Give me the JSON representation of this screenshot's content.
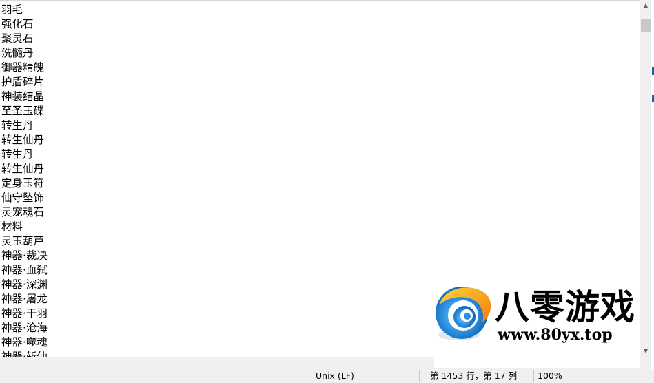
{
  "editor": {
    "lines": [
      "羽毛",
      "强化石",
      "聚灵石",
      "洗髓丹",
      "御器精魄",
      "护盾碎片",
      "神装结晶",
      "至圣玉碟",
      "转生丹",
      "转生仙丹",
      "转生丹",
      "转生仙丹",
      "定身玉符",
      "仙守坠饰",
      "灵宠魂石",
      "材料",
      "灵玉葫芦",
      "神器·裁决",
      "神器·血弑",
      "神器·深渊",
      "神器·屠龙",
      "神器·干羽",
      "神器·沧海",
      "神器·噬魂",
      "神器·斩仙"
    ]
  },
  "statusbar": {
    "line_ending": "Unix (LF)",
    "position": "第 1453 行，第 17 列",
    "zoom": "100%"
  },
  "watermark": {
    "name": "八零游戏",
    "url": "www.80yx.top",
    "logo_icon": "swirl-logo-icon"
  },
  "colors": {
    "logo_blue": "#1f7fd0",
    "logo_orange": "#f7a21b",
    "status_bg": "#f0f0f0"
  }
}
